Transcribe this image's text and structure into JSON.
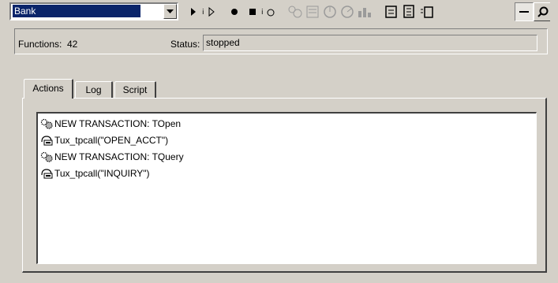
{
  "toolbar": {
    "combo_value": "Bank",
    "buttons": [
      {
        "icon": "play-icon"
      },
      {
        "icon": "step-icon"
      },
      {
        "icon": "record-icon"
      },
      {
        "icon": "stop-icon"
      },
      {
        "icon": "stop-play-icon"
      },
      {
        "icon": "transaction-icon"
      },
      {
        "icon": "list-icon"
      },
      {
        "icon": "timer-icon"
      },
      {
        "icon": "timer2-icon"
      },
      {
        "icon": "chart-icon"
      },
      {
        "icon": "export-icon"
      },
      {
        "icon": "script-icon"
      },
      {
        "icon": "indent-icon"
      },
      {
        "icon": "line-icon"
      },
      {
        "icon": "search-icon"
      }
    ]
  },
  "status": {
    "functions_label": "Functions:",
    "functions_value": "42",
    "status_label": "Status:",
    "status_value": "stopped"
  },
  "tabs": [
    {
      "label": "Actions"
    },
    {
      "label": "Log"
    },
    {
      "label": "Script"
    }
  ],
  "actions": [
    {
      "icon": "gears-icon",
      "text": "NEW TRANSACTION: TOpen"
    },
    {
      "icon": "call-icon",
      "text": "Tux_tpcall(\"OPEN_ACCT\")"
    },
    {
      "icon": "gears-icon",
      "text": "NEW TRANSACTION: TQuery"
    },
    {
      "icon": "call-icon",
      "text": "Tux_tpcall(\"INQUIRY\")"
    }
  ]
}
